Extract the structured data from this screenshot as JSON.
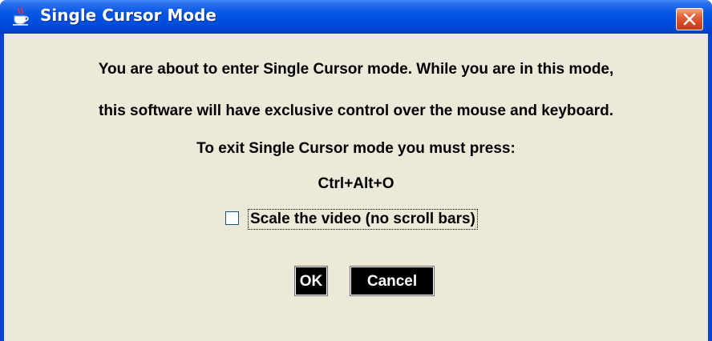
{
  "window": {
    "title": "Single Cursor Mode",
    "icon": "java-coffee-cup-icon",
    "close_icon": "close-x-icon",
    "colors": {
      "titlebar": "#0050e0",
      "close_button": "#d9542f",
      "client_background": "#ece9d8"
    }
  },
  "message": {
    "line1": "You are about to enter Single Cursor mode. While you are in this mode,",
    "line2": "this software will have exclusive control over the mouse and keyboard.",
    "line3": "To exit Single Cursor mode you must press:",
    "shortcut": "Ctrl+Alt+O"
  },
  "option": {
    "label": "Scale the video (no scroll bars)",
    "checked": false
  },
  "buttons": {
    "ok": "OK",
    "cancel": "Cancel"
  }
}
